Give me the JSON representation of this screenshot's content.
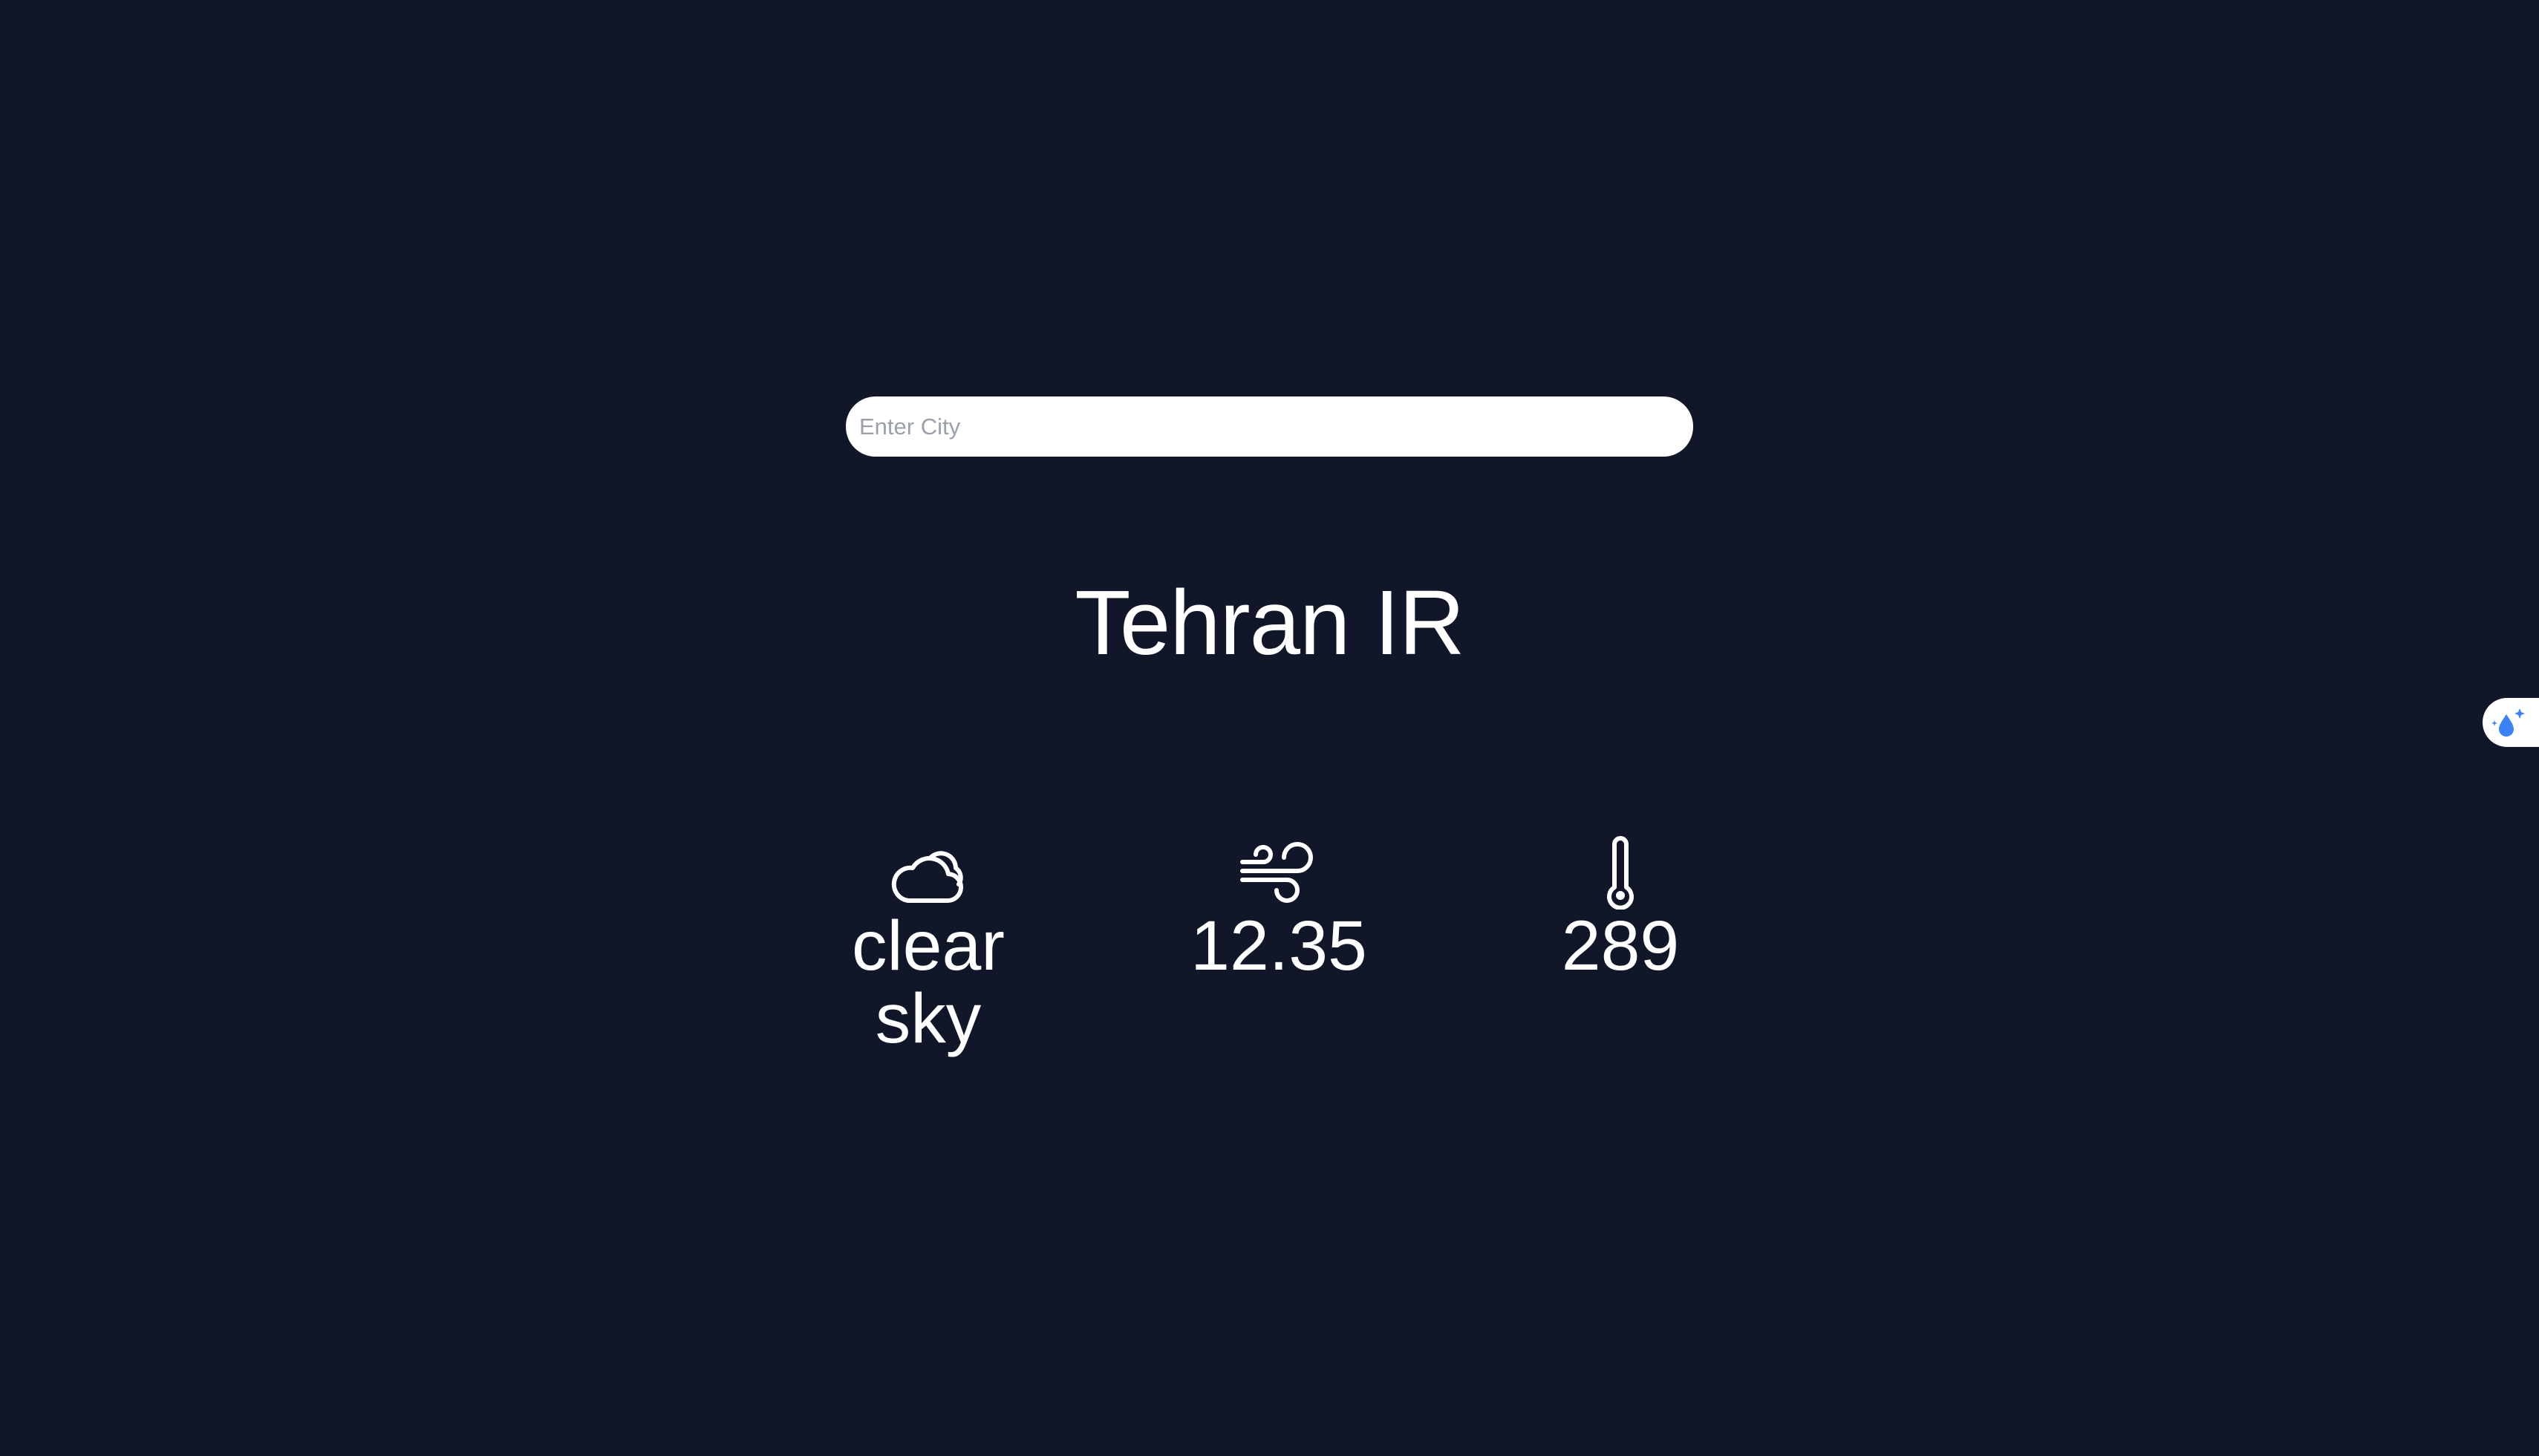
{
  "search": {
    "placeholder": "Enter City",
    "value": ""
  },
  "location": {
    "title": "Tehran IR"
  },
  "stats": {
    "description": {
      "icon": "cloud-icon",
      "value": "clear sky"
    },
    "wind": {
      "icon": "wind-icon",
      "value": "12.35"
    },
    "temperature": {
      "icon": "thermometer-icon",
      "value": "289"
    }
  },
  "side_widget": {
    "icon": "water-drop-sparkle-icon"
  },
  "colors": {
    "background": "#111729",
    "text": "#ffffff",
    "input_background": "#ffffff",
    "widget_accent": "#3b82f6"
  }
}
